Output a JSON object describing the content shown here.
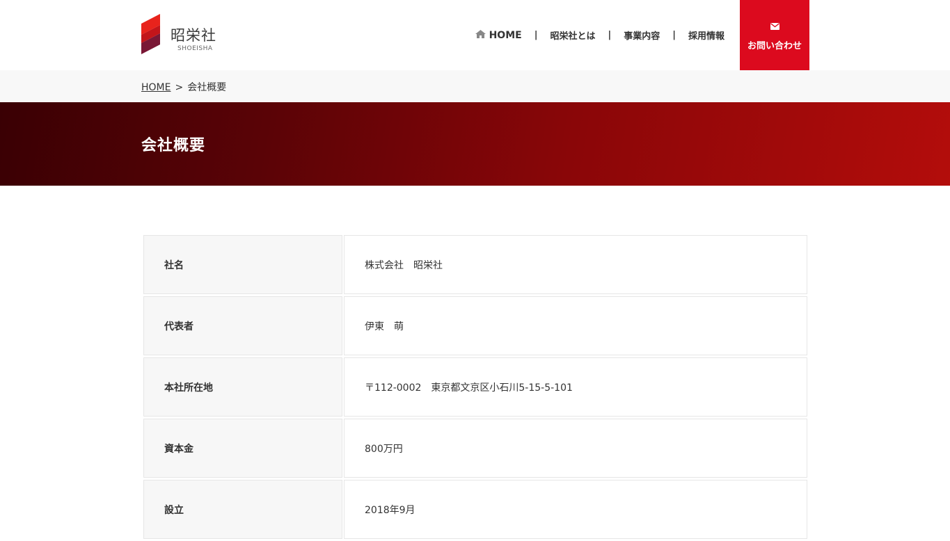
{
  "header": {
    "logo_name": "昭栄社",
    "logo_sub": "SHOEISHA",
    "nav": [
      {
        "label": "HOME",
        "icon": "home-icon"
      },
      {
        "label": "昭栄社とは"
      },
      {
        "label": "事業内容"
      },
      {
        "label": "採用情報"
      }
    ],
    "separator": "|",
    "contact": {
      "label": "お問い合わせ",
      "icon": "mail-icon",
      "color": "#dc0a1e"
    }
  },
  "breadcrumb": {
    "home": "HOME",
    "separator": ">",
    "current": "会社概要"
  },
  "hero": {
    "title": "会社概要"
  },
  "company_info": [
    {
      "label": "社名",
      "value": "株式会社　昭栄社"
    },
    {
      "label": "代表者",
      "value": "伊東　萌"
    },
    {
      "label": "本社所在地",
      "value": "〒112-0002　東京都文京区小石川5-15-5-101"
    },
    {
      "label": "資本金",
      "value": "800万円"
    },
    {
      "label": "設立",
      "value": "2018年9月"
    }
  ],
  "colors": {
    "accent": "#dc0a1e",
    "hero_dark": "#3a0004",
    "hero_light": "#b30d0b"
  }
}
